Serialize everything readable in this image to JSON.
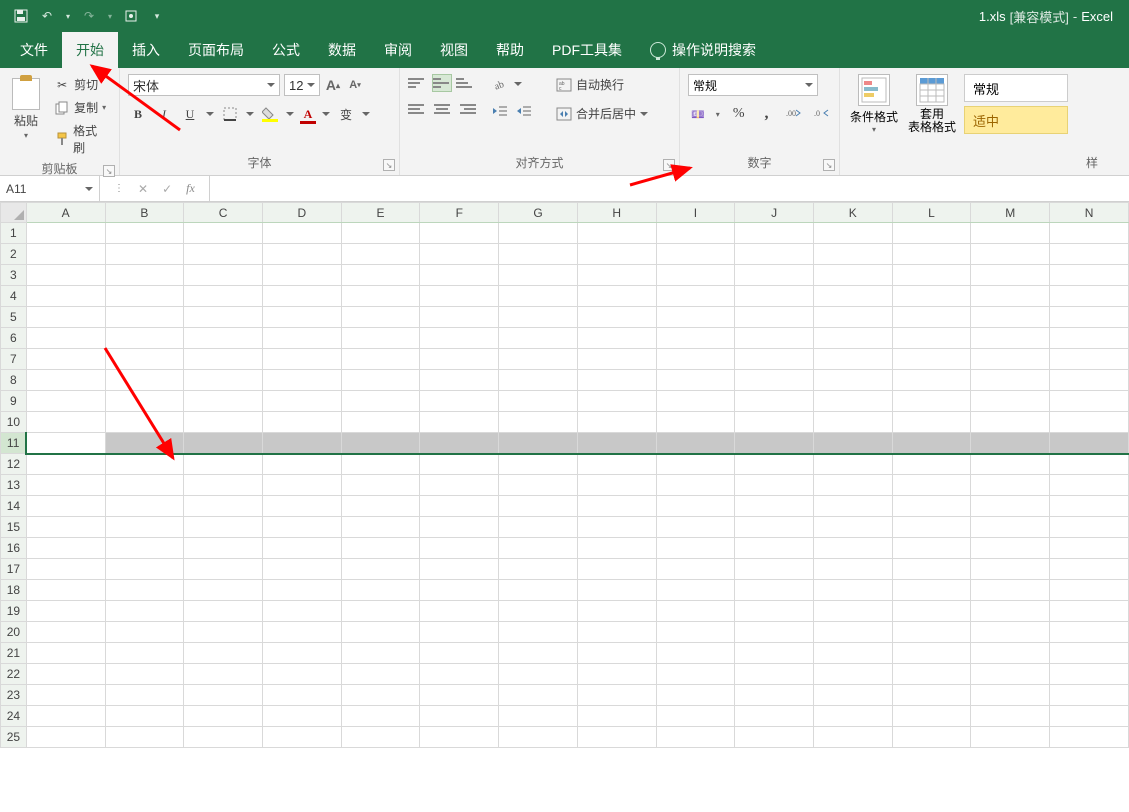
{
  "title": {
    "filename": "1.xls",
    "mode": "[兼容模式]",
    "sep": "-",
    "app": "Excel"
  },
  "tabs": [
    "文件",
    "开始",
    "插入",
    "页面布局",
    "公式",
    "数据",
    "审阅",
    "视图",
    "帮助",
    "PDF工具集"
  ],
  "tell_me": "操作说明搜索",
  "ribbon": {
    "clipboard": {
      "title": "剪贴板",
      "paste": "粘贴",
      "cut": "剪切",
      "copy": "复制",
      "painter": "格式刷"
    },
    "font": {
      "title": "字体",
      "name": "宋体",
      "size": "12",
      "grow": "A",
      "shrink": "A",
      "bold": "B",
      "italic": "I",
      "underline": "U"
    },
    "align": {
      "title": "对齐方式",
      "wrap": "自动换行",
      "merge": "合并后居中"
    },
    "number": {
      "title": "数字",
      "format": "常规",
      "percent": "%",
      "comma": ","
    },
    "styles": {
      "cond": "条件格式",
      "table": "套用\n表格格式",
      "normal": "常规",
      "neutral": "适中"
    }
  },
  "namebox": "A11",
  "columns": [
    "A",
    "B",
    "C",
    "D",
    "E",
    "F",
    "G",
    "H",
    "I",
    "J",
    "K",
    "L",
    "M",
    "N"
  ],
  "rows": [
    1,
    2,
    3,
    4,
    5,
    6,
    7,
    8,
    9,
    10,
    11,
    12,
    13,
    14,
    15,
    16,
    17,
    18,
    19,
    20,
    21,
    22,
    23,
    24,
    25
  ],
  "selected_row": 11
}
